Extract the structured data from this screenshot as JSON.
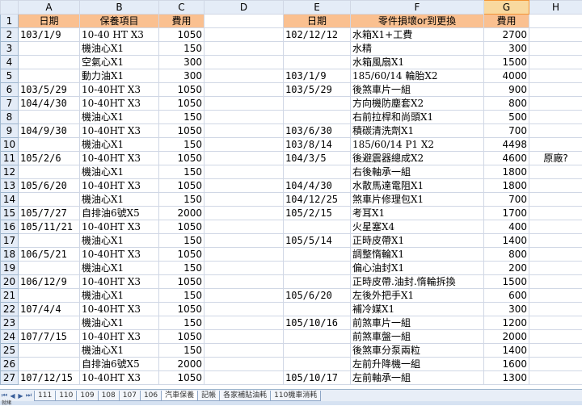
{
  "columns": [
    "A",
    "B",
    "C",
    "D",
    "E",
    "F",
    "G",
    "H"
  ],
  "header": [
    "日期",
    "保養項目",
    "費用",
    "",
    "日期",
    "零件損壞or到更換",
    "費用",
    ""
  ],
  "rows": [
    [
      "103/1/9",
      "10-40 HT X3",
      "1050",
      "",
      "102/12/12",
      "水箱X1+工費",
      "2700",
      ""
    ],
    [
      "",
      "機油心X1",
      "150",
      "",
      "",
      "水精",
      "300",
      ""
    ],
    [
      "",
      "空氣心X1",
      "300",
      "",
      "",
      "水箱風扇X1",
      "1500",
      ""
    ],
    [
      "",
      "動力油X1",
      "300",
      "",
      "103/1/9",
      "185/60/14 輪胎X2",
      "4000",
      ""
    ],
    [
      "103/5/29",
      "10-40HT X3",
      "1050",
      "",
      "103/5/29",
      "後煞車片一組",
      "900",
      ""
    ],
    [
      "104/4/30",
      "10-40HT X3",
      "1050",
      "",
      "",
      "方向機防塵套X2",
      "800",
      ""
    ],
    [
      "",
      "機油心X1",
      "150",
      "",
      "",
      "右前拉桿和尚頭X1",
      "500",
      ""
    ],
    [
      "104/9/30",
      "10-40HT X3",
      "1050",
      "",
      "103/6/30",
      "積碳清洗劑X1",
      "700",
      ""
    ],
    [
      "",
      "機油心X1",
      "150",
      "",
      "103/8/14",
      "185/60/14 P1 X2",
      "4498",
      ""
    ],
    [
      "105/2/6",
      "10-40HT X3",
      "1050",
      "",
      "104/3/5",
      "後避震器總成X2",
      "4600",
      "原廠?"
    ],
    [
      "",
      "機油心X1",
      "150",
      "",
      "",
      "右後軸承一組",
      "1800",
      ""
    ],
    [
      "105/6/20",
      "10-40HT X3",
      "1050",
      "",
      "104/4/30",
      "水散馬達電阻X1",
      "1800",
      ""
    ],
    [
      "",
      "機油心X1",
      "150",
      "",
      "104/12/25",
      "煞車片修理包X1",
      "700",
      ""
    ],
    [
      "105/7/27",
      "自排油6號X5",
      "2000",
      "",
      "105/2/15",
      "考耳X1",
      "1700",
      ""
    ],
    [
      "105/11/21",
      "10-40HT X3",
      "1050",
      "",
      "",
      "火星塞X4",
      "400",
      ""
    ],
    [
      "",
      "機油心X1",
      "150",
      "",
      "105/5/14",
      "正時皮帶X1",
      "1400",
      ""
    ],
    [
      "106/5/21",
      "10-40HT X3",
      "1050",
      "",
      "",
      "調整惰輪X1",
      "800",
      ""
    ],
    [
      "",
      "機油心X1",
      "150",
      "",
      "",
      "偏心油封X1",
      "200",
      ""
    ],
    [
      "106/12/9",
      "10-40HT X3",
      "1050",
      "",
      "",
      "正時皮帶.油封.惰輪拆換",
      "1500",
      ""
    ],
    [
      "",
      "機油心X1",
      "150",
      "",
      "105/6/20",
      "左後外把手X1",
      "600",
      ""
    ],
    [
      "107/4/4",
      "10-40HT X3",
      "1050",
      "",
      "",
      "補冷媒X1",
      "300",
      ""
    ],
    [
      "",
      "機油心X1",
      "150",
      "",
      "105/10/16",
      "前煞車片一組",
      "1200",
      ""
    ],
    [
      "107/7/15",
      "10-40HT X3",
      "1050",
      "",
      "",
      "前煞車盤一組",
      "2000",
      ""
    ],
    [
      "",
      "機油心X1",
      "150",
      "",
      "",
      "後煞車分泵兩粒",
      "1400",
      ""
    ],
    [
      "",
      "自排油6號X5",
      "2000",
      "",
      "",
      "左前升降機一組",
      "1600",
      ""
    ],
    [
      "107/12/15",
      "10-40HT X3",
      "1050",
      "",
      "105/10/17",
      "左前軸承一組",
      "1300",
      ""
    ]
  ],
  "row_numbers": [
    "1",
    "2",
    "3",
    "4",
    "5",
    "6",
    "7",
    "8",
    "9",
    "10",
    "11",
    "12",
    "13",
    "14",
    "15",
    "16",
    "17",
    "18",
    "19",
    "20",
    "21",
    "22",
    "23",
    "24",
    "25",
    "26",
    "27"
  ],
  "sheet_tabs": [
    "111",
    "110",
    "109",
    "108",
    "107",
    "106",
    "汽車保養",
    "記帳",
    "各家補貼油耗",
    "110機車消耗"
  ],
  "status": "就緒"
}
